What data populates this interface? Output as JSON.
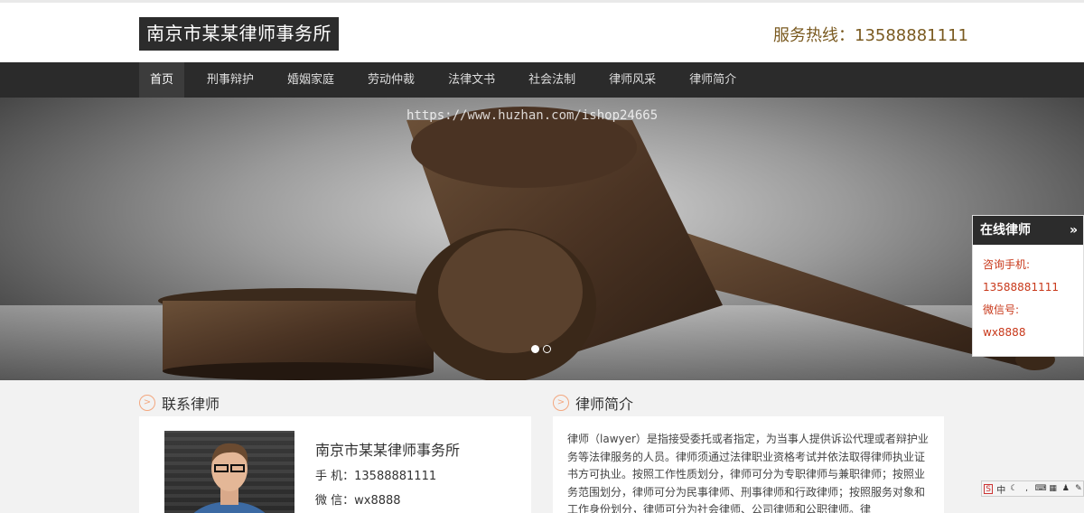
{
  "header": {
    "logo_text": "南京市某某律师事务所",
    "hotline": "服务热线：13588881111"
  },
  "nav": {
    "items": [
      {
        "label": "首页",
        "active": true
      },
      {
        "label": "刑事辩护"
      },
      {
        "label": "婚姻家庭"
      },
      {
        "label": "劳动仲裁"
      },
      {
        "label": "法律文书"
      },
      {
        "label": "社会法制"
      },
      {
        "label": "律师风采"
      },
      {
        "label": "律师简介"
      }
    ]
  },
  "banner": {
    "watermark": "https://www.huzhan.com/ishop24665",
    "slide_count": 2,
    "active_slide": 1
  },
  "float_panel": {
    "title": "在线律师",
    "phone_label": "咨询手机:",
    "phone": "13588881111",
    "wechat_label": "微信号:",
    "wechat": "wx8888"
  },
  "contact": {
    "title": "联系律师",
    "firm_name": "南京市某某律师事务所",
    "phone_line": "手 机：13588881111",
    "wechat_line": "微 信：wx8888"
  },
  "intro": {
    "title": "律师简介",
    "text": "律师（lawyer）是指接受委托或者指定，为当事人提供诉讼代理或者辩护业务等法律服务的人员。律师须通过法律职业资格考试并依法取得律师执业证书方可执业。按照工作性质划分，律师可分为专职律师与兼职律师；按照业务范围划分，律师可分为民事律师、刑事律师和行政律师；按照服务对象和工作身份划分，律师可分为社会律师、公司律师和公职律师。律"
  },
  "tray": {
    "lang": "中"
  },
  "colors": {
    "nav_bg": "#2b2b2b",
    "accent_text": "#c8381a",
    "hotline": "#7a5a20"
  }
}
